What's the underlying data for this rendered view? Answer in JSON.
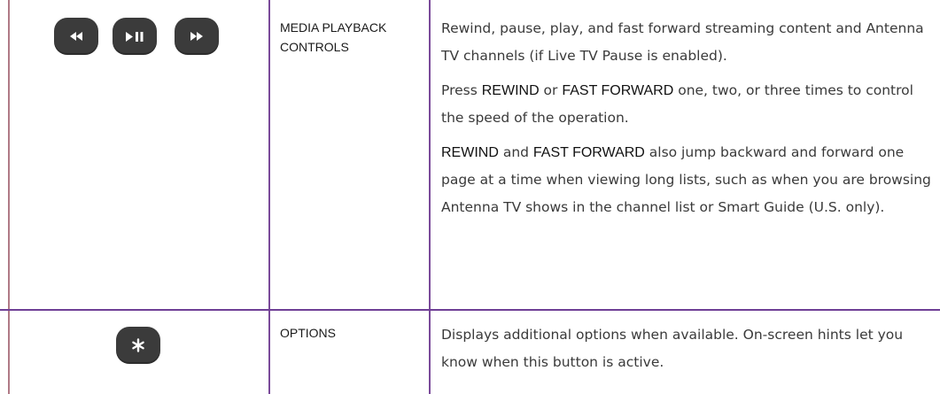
{
  "rows": [
    {
      "name": "MEDIA PLAYBACK CONTROLS",
      "icons": [
        "rewind-icon",
        "play-pause-icon",
        "fast-forward-icon"
      ],
      "paragraphs": [
        {
          "parts": [
            "Rewind, pause, play, and fast forward streaming content and Antenna TV channels (if Live TV Pause is enabled)."
          ]
        },
        {
          "parts": [
            "Press ",
            "REWIND",
            " or ",
            "FAST FORWARD",
            " one, two, or three times to control the speed of the operation."
          ]
        },
        {
          "parts": [
            "REWIND",
            " and ",
            "FAST FORWARD",
            " also jump backward and forward one page at a time when viewing long lists, such as when you are browsing Antenna TV shows in the channel list or Smart Guide (U.S. only)."
          ]
        }
      ]
    },
    {
      "name": "OPTIONS",
      "icons": [
        "asterisk-icon"
      ],
      "paragraphs": [
        {
          "parts": [
            "Displays additional options when available. On-screen hints let you know when this button is active."
          ]
        }
      ]
    }
  ],
  "colors": {
    "row_divider": "#6f3f96",
    "column_divider": "#7a4a9a",
    "left_border": "#b07a86",
    "button_fill": "#3b3b3b",
    "button_glyph": "#ffffff"
  }
}
